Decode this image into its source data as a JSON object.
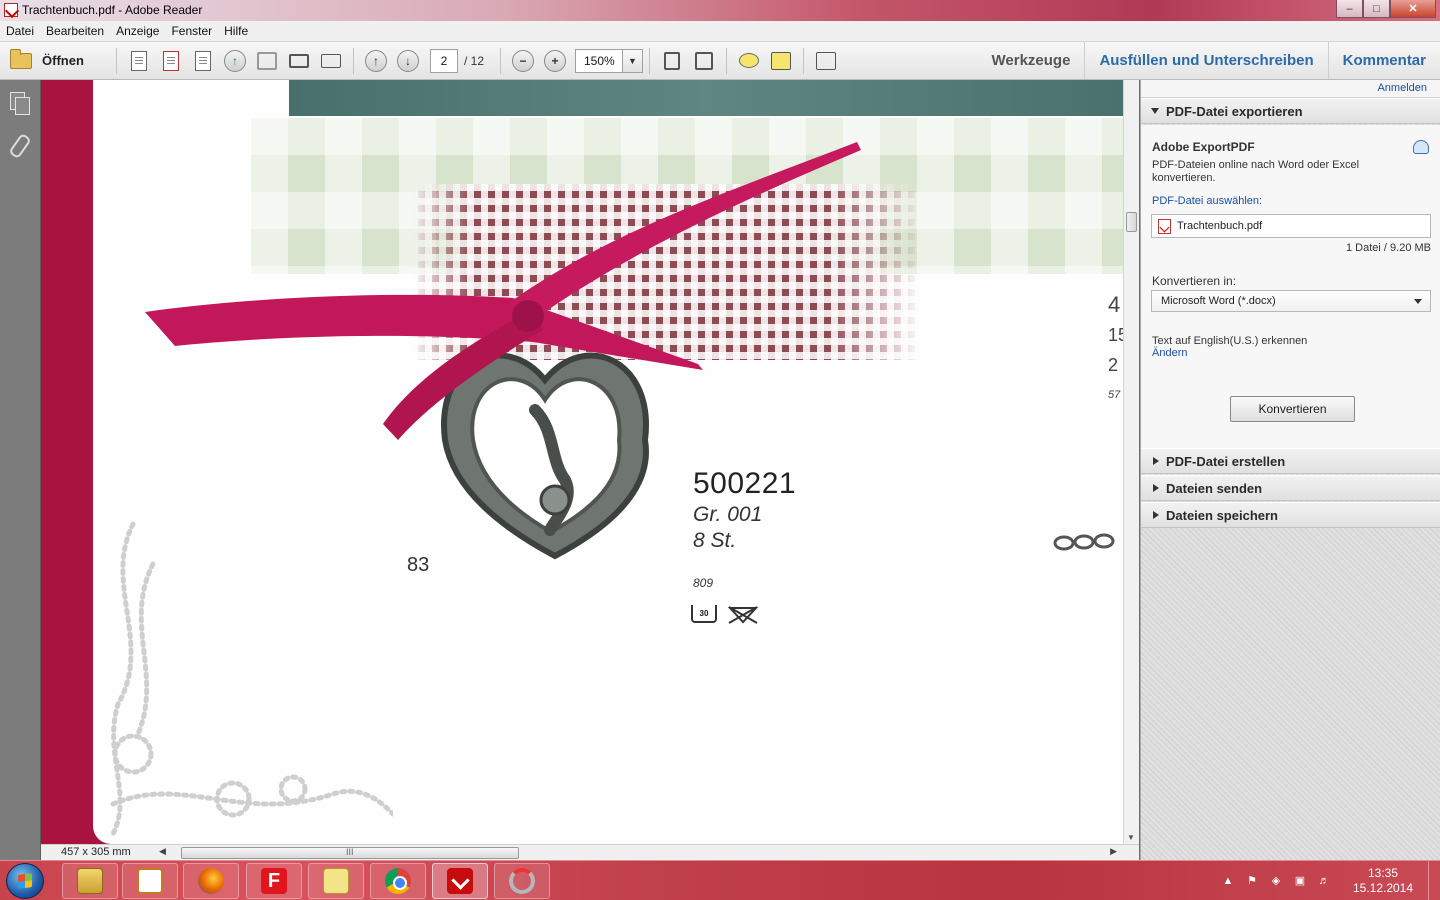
{
  "window": {
    "title": "Trachtenbuch.pdf - Adobe Reader",
    "controls": {
      "minimize": "–",
      "maximize": "□",
      "close": "✕"
    }
  },
  "menu": [
    "Datei",
    "Bearbeiten",
    "Anzeige",
    "Fenster",
    "Hilfe"
  ],
  "toolbar": {
    "open_label": "Öffnen",
    "current_page": "2",
    "total_pages": "/ 12",
    "zoom": "150%",
    "tabs": {
      "tools": "Werkzeuge",
      "fill_sign": "Ausfüllen und Unterschreiben",
      "comment": "Kommentar"
    },
    "icons": [
      "create-pdf-icon",
      "combine-icon",
      "edit-icon",
      "upload-icon",
      "save-icon",
      "print-icon",
      "email-icon",
      "page-up-icon",
      "page-down-icon",
      "zoom-out-icon",
      "zoom-in-icon",
      "fit-page-icon",
      "fit-width-icon",
      "comment-icon",
      "highlight-icon",
      "fullscreen-icon"
    ]
  },
  "document": {
    "product_number": "500221",
    "size": "Gr. 001",
    "quantity": "8 St.",
    "code": "809",
    "page_number": "83",
    "wash_temp": "30",
    "edge_text": [
      "4",
      "15",
      "2",
      "57"
    ]
  },
  "status": {
    "dimensions": "457 x 305 mm",
    "scroll_grip": "III"
  },
  "panel": {
    "login": "Anmelden",
    "export": {
      "header": "PDF-Datei exportieren",
      "title": "Adobe ExportPDF",
      "description": "PDF-Dateien online nach Word oder Excel konvertieren.",
      "choose_label": "PDF-Datei auswählen:",
      "file_name": "Trachtenbuch.pdf",
      "file_count": "1 Datei / 9.20 MB",
      "convert_to_label": "Konvertieren in:",
      "format": "Microsoft Word (*.docx)",
      "ocr_text": "Text auf English(U.S.) erkennen",
      "ocr_change": "Ändern",
      "convert_button": "Konvertieren"
    },
    "sections": [
      "PDF-Datei erstellen",
      "Dateien senden",
      "Dateien speichern"
    ]
  },
  "taskbar": {
    "apps": [
      "explorer",
      "media-player",
      "firefox",
      "f-app",
      "notes",
      "chrome",
      "adobe-reader",
      "app-spinner"
    ],
    "time": "13:35",
    "date": "15.12.2014"
  },
  "colors": {
    "accent_blue": "#2d6aa8",
    "ribbon": "#c2185b",
    "doc_background": "#a8143f"
  }
}
